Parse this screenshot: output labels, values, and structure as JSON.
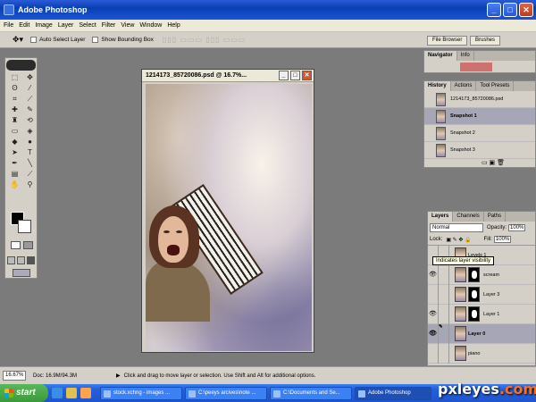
{
  "app": {
    "title": "Adobe Photoshop"
  },
  "menu": [
    "File",
    "Edit",
    "Image",
    "Layer",
    "Select",
    "Filter",
    "View",
    "Window",
    "Help"
  ],
  "options": {
    "auto_select": "Auto Select Layer",
    "bounding_box": "Show Bounding Box"
  },
  "palette_well": {
    "file_browser": "File Browser",
    "brushes": "Brushes"
  },
  "document": {
    "title": "1214173_85720086.psd @ 16.7%..."
  },
  "navigator": {
    "tabs": [
      "Navigator",
      "Info"
    ]
  },
  "history": {
    "tabs": [
      "History",
      "Actions",
      "Tool Presets"
    ],
    "rows": [
      {
        "label": "1214173_85720086.psd",
        "selected": false
      },
      {
        "label": "Snapshot 1",
        "selected": true
      },
      {
        "label": "Snapshot 2",
        "selected": false
      },
      {
        "label": "Snapshot 3",
        "selected": false
      }
    ]
  },
  "layers": {
    "tabs": [
      "Layers",
      "Channels",
      "Paths"
    ],
    "blend_mode": "Normal",
    "opacity_label": "Opacity:",
    "opacity_value": "100%",
    "lock_label": "Lock:",
    "fill_label": "Fill:",
    "fill_value": "100%",
    "tooltip": "Indicates layer visibility",
    "rows": [
      {
        "name": "Levels 1",
        "visible": false,
        "mask": false,
        "selected": false
      },
      {
        "name": "scream",
        "visible": true,
        "mask": true,
        "selected": false
      },
      {
        "name": "Layer 3",
        "visible": false,
        "mask": true,
        "selected": false
      },
      {
        "name": "Layer 1",
        "visible": true,
        "mask": true,
        "selected": false
      },
      {
        "name": "Layer 0",
        "visible": true,
        "mask": false,
        "selected": true
      },
      {
        "name": "piano",
        "visible": false,
        "mask": false,
        "selected": false
      }
    ]
  },
  "status": {
    "zoom": "16.67%",
    "doc": "Doc: 16.9M/94.3M",
    "hint": "Click and drag to move layer or selection. Use Shift and Alt for additional options."
  },
  "taskbar": {
    "start": "start",
    "tasks": [
      {
        "label": "stock.xchng - images ...",
        "active": false
      },
      {
        "label": "C:\\peeys arcives\\note ...",
        "active": false
      },
      {
        "label": "C:\\Documents and Se...",
        "active": false
      },
      {
        "label": "Adobe Photoshop",
        "active": true
      }
    ]
  },
  "watermark": {
    "text": "pxleyes",
    "suffix": ".com"
  }
}
